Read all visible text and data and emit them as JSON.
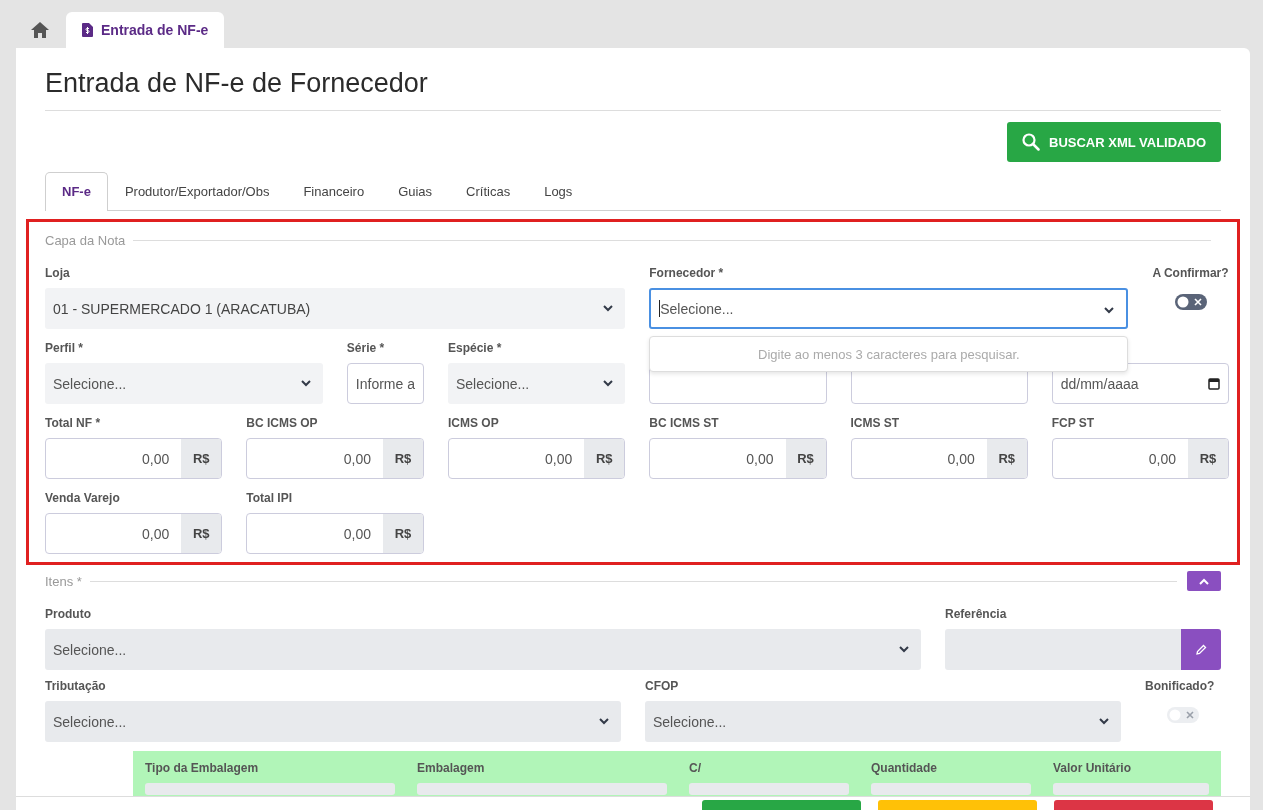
{
  "top_tabs": [
    {
      "kind": "home",
      "selected": false
    },
    {
      "kind": "page",
      "label": "Entrada de NF-e",
      "selected": true
    }
  ],
  "page_title": "Entrada de NF-e de Fornecedor",
  "search_button": {
    "label": "BUSCAR XML VALIDADO"
  },
  "tabs": [
    {
      "label": "NF-e",
      "selected": true
    },
    {
      "label": "Produtor/Exportador/Obs",
      "selected": false
    },
    {
      "label": "Financeiro",
      "selected": false
    },
    {
      "label": "Guias",
      "selected": false
    },
    {
      "label": "Críticas",
      "selected": false
    },
    {
      "label": "Logs",
      "selected": false
    }
  ],
  "capa": {
    "legend": "Capa da Nota",
    "fields": [
      {
        "kind": "select",
        "label": "Loja",
        "value": "01 - SUPERMERCADO 1 (ARACATUBA)"
      },
      {
        "kind": "select",
        "label": "Fornecedor *",
        "placeholder": "Selecione...",
        "focused": true,
        "dropdown": "Digite ao menos 3 caracteres para pesquisar."
      },
      {
        "kind": "toggle",
        "label": "A Confirmar?",
        "on": false,
        "disabled": false
      },
      {
        "kind": "select",
        "label": "Perfil *",
        "placeholder": "Selecione..."
      },
      {
        "kind": "text",
        "label": "Série *",
        "placeholder": "Informe a"
      },
      {
        "kind": "select",
        "label": "Espécie *",
        "placeholder": "Selecione..."
      },
      {
        "kind": "number"
      },
      {
        "kind": "date"
      },
      {
        "kind": "date",
        "placeholder": "dd/mm/aaaa"
      },
      {
        "kind": "money",
        "label": "Total NF *",
        "value": "0,00",
        "addon": "R$"
      },
      {
        "kind": "money",
        "label": "BC ICMS OP",
        "value": "0,00",
        "addon": "R$"
      },
      {
        "kind": "money",
        "label": "ICMS OP",
        "value": "0,00",
        "addon": "R$"
      },
      {
        "kind": "money",
        "label": "BC ICMS ST",
        "value": "0,00",
        "addon": "R$"
      },
      {
        "kind": "money",
        "label": "ICMS ST",
        "value": "0,00",
        "addon": "R$"
      },
      {
        "kind": "money",
        "label": "FCP ST",
        "value": "0,00",
        "addon": "R$"
      },
      {
        "kind": "money",
        "label": "Venda Varejo",
        "value": "0,00",
        "addon": "R$"
      },
      {
        "kind": "money",
        "label": "Total IPI",
        "value": "0,00",
        "addon": "R$"
      }
    ]
  },
  "itens": {
    "legend": "Itens *",
    "expanded": true,
    "fields": [
      {
        "kind": "select",
        "label": "Produto",
        "placeholder": "Selecione..."
      },
      {
        "kind": "edit",
        "label": "Referência"
      },
      {
        "kind": "select",
        "label": "Tributação",
        "placeholder": "Selecione..."
      },
      {
        "kind": "select",
        "label": "CFOP",
        "placeholder": "Selecione..."
      },
      {
        "kind": "toggle",
        "label": "Bonificado?",
        "on": false,
        "disabled": true
      }
    ],
    "packaging": {
      "columns": [
        "Tipo da Embalagem",
        "Embalagem",
        "C/",
        "Quantidade",
        "Valor Unitário"
      ]
    }
  },
  "footer": {
    "buttons": [
      {
        "color": "#28a745"
      },
      {
        "color": "#ffc107"
      },
      {
        "color": "#dc3545"
      }
    ]
  }
}
